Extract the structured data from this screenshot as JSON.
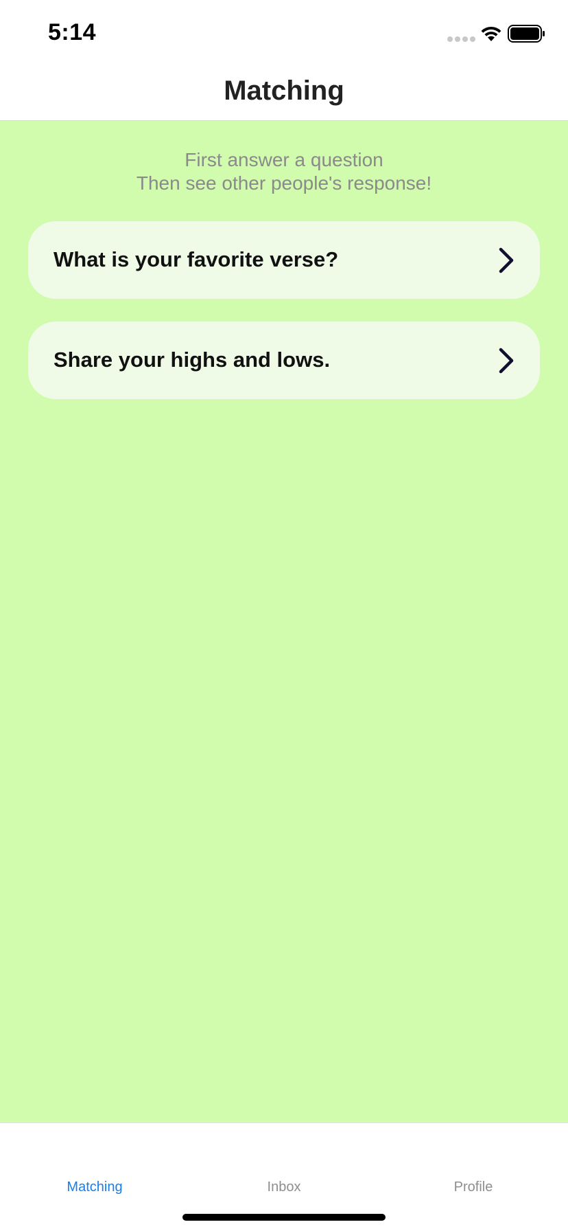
{
  "status_bar": {
    "time": "5:14",
    "icons": [
      "signal-dots-icon",
      "wifi-icon",
      "battery-icon"
    ]
  },
  "nav": {
    "title": "Matching"
  },
  "content": {
    "subtitle_line1": "First answer a question",
    "subtitle_line2": "Then see other people's response!",
    "questions": [
      {
        "label": "What is your favorite verse?",
        "icon": "chevron-right-icon"
      },
      {
        "label": "Share your highs and lows.",
        "icon": "chevron-right-icon"
      }
    ]
  },
  "tab_bar": {
    "tabs": [
      {
        "label": "Matching",
        "active": true
      },
      {
        "label": "Inbox",
        "active": false
      },
      {
        "label": "Profile",
        "active": false
      }
    ]
  },
  "colors": {
    "background": "#d1fbad",
    "card": "#effbe6",
    "active_tab": "#1a7ee6",
    "inactive_tab": "#8e8e8e",
    "subtitle": "#8a8a8a"
  }
}
